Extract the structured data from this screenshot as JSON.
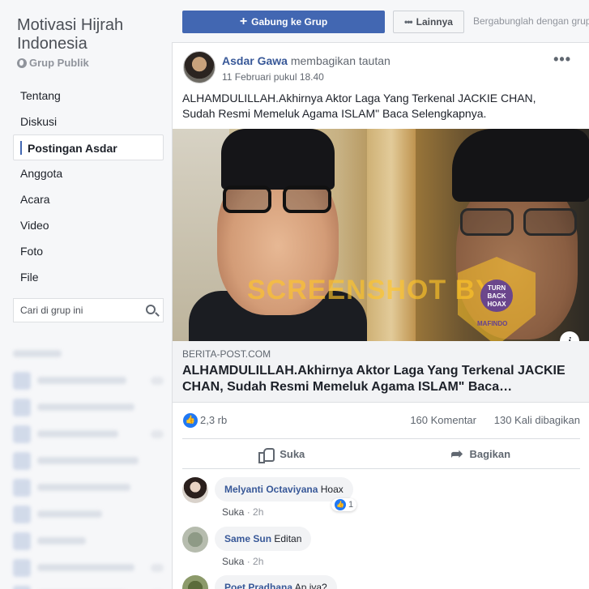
{
  "group": {
    "name": "Motivasi Hijrah Indonesia",
    "privacy": "Grup Publik"
  },
  "nav": {
    "items": [
      {
        "label": "Tentang",
        "active": false
      },
      {
        "label": "Diskusi",
        "active": false
      },
      {
        "label": "Postingan Asdar",
        "active": true
      },
      {
        "label": "Anggota",
        "active": false
      },
      {
        "label": "Acara",
        "active": false
      },
      {
        "label": "Video",
        "active": false
      },
      {
        "label": "Foto",
        "active": false
      },
      {
        "label": "File",
        "active": false
      }
    ]
  },
  "search": {
    "placeholder": "Cari di grup ini"
  },
  "topbar": {
    "join_label": "Gabung ke Grup",
    "more_label": "Lainnya",
    "join_prompt": "Bergabunglah dengan grup"
  },
  "post": {
    "author": "Asdar Gawa",
    "action": "membagikan tautan",
    "time": "11 Februari pukul 18.40",
    "text": "ALHAMDULILLAH.Akhirnya Aktor Laga Yang Terkenal JACKIE CHAN, Sudah Resmi Memeluk Agama ISLAM\" Baca Selengkapnya.",
    "image_watermark": "SCREENSHOT BY",
    "badge_text": "TURN BACK HOAX",
    "badge_label": "MAFINDO",
    "link": {
      "domain": "BERITA-POST.COM",
      "title": "ALHAMDULILLAH.Akhirnya Aktor Laga Yang Terkenal JACKIE CHAN, Sudah Resmi Memeluk Agama ISLAM\" Baca…"
    },
    "stats": {
      "reactions": "2,3 rb",
      "comments": "160 Komentar",
      "shares": "130 Kali dibagikan"
    },
    "actions": {
      "like": "Suka",
      "share": "Bagikan"
    }
  },
  "comments": [
    {
      "name": "Melyanti Octaviyana",
      "text": "Hoax",
      "like_label": "Suka",
      "time": "2h",
      "reactions": "1"
    },
    {
      "name": "Same Sun",
      "text": "Editan",
      "like_label": "Suka",
      "time": "2h"
    },
    {
      "name": "Poet Pradhana",
      "text": "Ap iya?"
    }
  ],
  "colors": {
    "brand_blue": "#4267b2",
    "link_blue": "#385898",
    "like_blue": "#2078f4",
    "watermark": "#ffc428"
  }
}
